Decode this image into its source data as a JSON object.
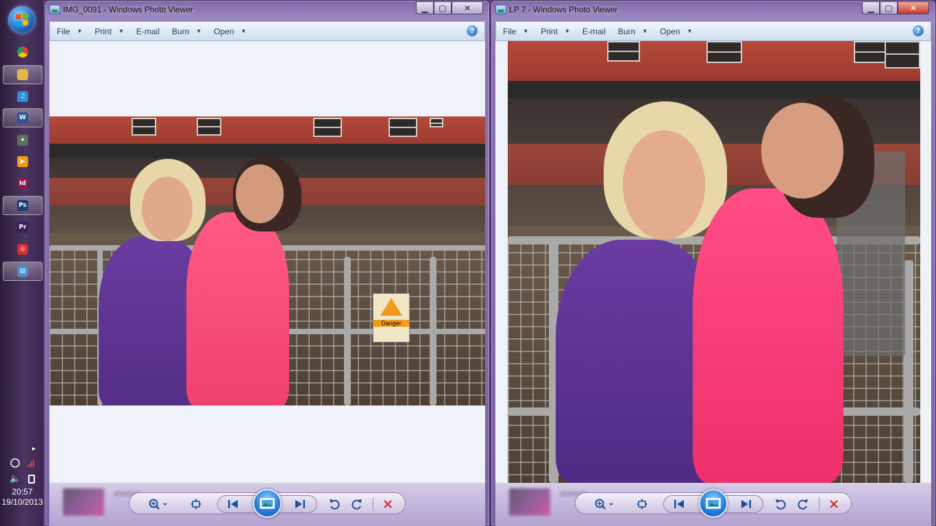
{
  "taskbar": {
    "items": [
      {
        "name": "chrome-icon",
        "glyph": "",
        "color": "#e34234",
        "active": false
      },
      {
        "name": "explorer-icon",
        "glyph": "",
        "color": "#e0b84a",
        "active": true
      },
      {
        "name": "itunes-icon",
        "glyph": "♫",
        "color": "#2d8ed8",
        "active": false
      },
      {
        "name": "word-icon",
        "glyph": "W",
        "color": "#2b5797",
        "active": true
      },
      {
        "name": "gamepad-icon",
        "glyph": "✦",
        "color": "#5f6f5f",
        "active": false
      },
      {
        "name": "media-player-icon",
        "glyph": "▶",
        "color": "#f39c12",
        "active": false
      },
      {
        "name": "indesign-icon",
        "glyph": "Id",
        "color": "#8a1a4a",
        "active": false
      },
      {
        "name": "photoshop-icon",
        "glyph": "Ps",
        "color": "#1b3e6e",
        "active": true
      },
      {
        "name": "premiere-icon",
        "glyph": "Pr",
        "color": "#3a1f5c",
        "active": false
      },
      {
        "name": "creative-cloud-icon",
        "glyph": "◎",
        "color": "#d42d2d",
        "active": false
      },
      {
        "name": "photo-viewer-icon",
        "glyph": "▤",
        "color": "#4a90d0",
        "active": true
      }
    ],
    "tray": {
      "expand_glyph": "▸",
      "time": "20:57",
      "date": "19/10/2013"
    }
  },
  "windows": [
    {
      "title": "IMG_0091 - Windows Photo Viewer",
      "menu": [
        {
          "label": "File",
          "has_caret": true
        },
        {
          "label": "Print",
          "has_caret": true
        },
        {
          "label": "E-mail",
          "has_caret": false
        },
        {
          "label": "Burn",
          "has_caret": true
        },
        {
          "label": "Open",
          "has_caret": true
        }
      ],
      "help": "?",
      "close_glyph": "✕",
      "min_glyph": "▁",
      "max_glyph": "▢"
    },
    {
      "title": "LP 7 - Windows Photo Viewer",
      "menu": [
        {
          "label": "File",
          "has_caret": true
        },
        {
          "label": "Print",
          "has_caret": true
        },
        {
          "label": "E-mail",
          "has_caret": false
        },
        {
          "label": "Burn",
          "has_caret": true
        },
        {
          "label": "Open",
          "has_caret": true
        }
      ],
      "help": "?",
      "close_glyph": "✕",
      "min_glyph": "▁",
      "max_glyph": "▢"
    }
  ],
  "sign_text": "Danger",
  "colors": {
    "menu_text": "#1e395b",
    "control_blue": "#1d4f99",
    "delete_red": "#d22a2a"
  }
}
